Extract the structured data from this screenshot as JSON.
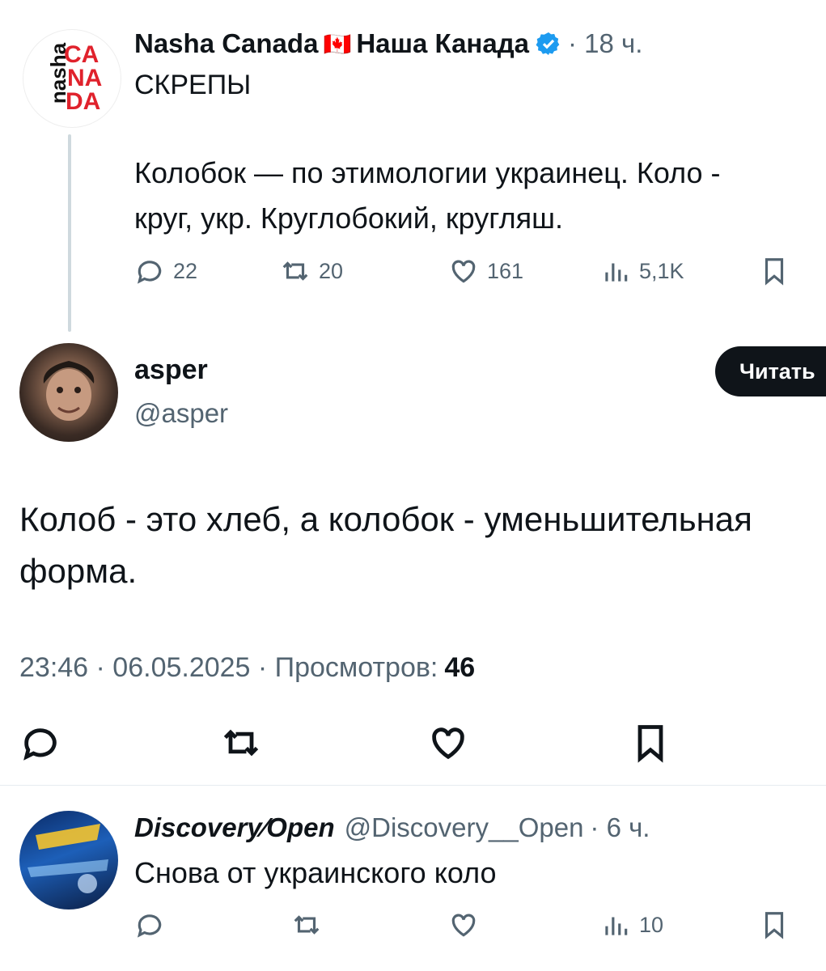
{
  "tweet1": {
    "display_name": "Nasha Canada",
    "flag": "🇨🇦",
    "display_name_ru": "Наша Канада",
    "time": "· 18 ч.",
    "line1": "СКРЕПЫ",
    "line2": "Колобок — по этимологии украинец. Коло -",
    "line3": "круг, укр. Круглобокий, кругляш.",
    "stats": {
      "replies": "22",
      "reposts": "20",
      "likes": "161",
      "views": "5,1K"
    },
    "avatar_text": {
      "side": "nasha",
      "ca": "CA",
      "na": "NA",
      "da": "DA"
    }
  },
  "tweet2": {
    "display_name": "asper",
    "handle": "@asper",
    "follow_label": "Читать",
    "body_line1": "Колоб - это хлеб, а колобок - уменьшительная",
    "body_line2": "форма.",
    "meta": "23:46 · 06.05.2025 · Просмотров:",
    "views": "46"
  },
  "tweet3": {
    "display_name": "Discovery⁄Open",
    "handle": "@Discovery__Open",
    "time": "· 6 ч.",
    "body": "Снова от украинского коло",
    "views": "10"
  },
  "icons": [
    "reply-icon",
    "repost-icon",
    "like-icon",
    "views-icon",
    "bookmark-icon",
    "verified-icon"
  ],
  "colors": {
    "text": "#0f1419",
    "muted": "#536471",
    "verified": "#1d9bf0",
    "avatar_red": "#e0222c"
  }
}
